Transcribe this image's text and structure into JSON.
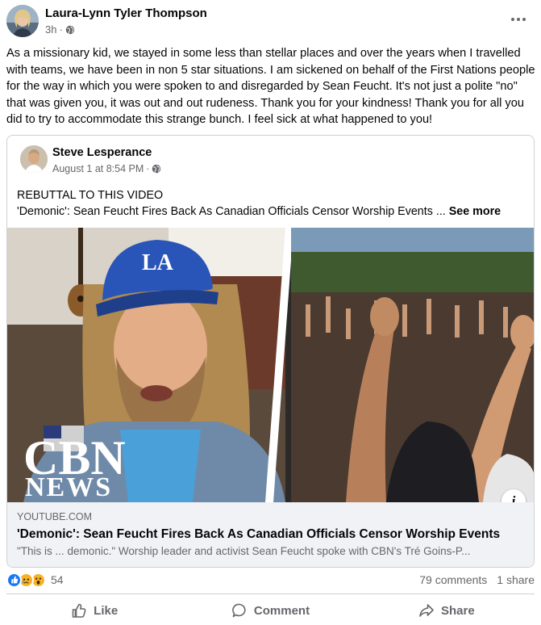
{
  "post": {
    "author": "Laura-Lynn Tyler Thompson",
    "time": "3h",
    "time_separator": "·",
    "privacy_icon": "globe-icon",
    "text": "As a missionary kid, we stayed in some less than stellar places and over the years when I travelled with teams, we have been in non 5 star situations.  I am sickened on behalf of the First Nations people for the way in which you were spoken to and disregarded by Sean Feucht.   It's not just a polite \"no\" that was given you, it was out and out rudeness. Thank you for your kindness!  Thank you for all you did to try to accommodate this strange bunch.  I feel sick at what happened to you!"
  },
  "shared": {
    "author": "Steve Lesperance",
    "date": "August 1 at 8:54 PM",
    "time_separator": "·",
    "text_line1": "REBUTTAL TO THIS VIDEO",
    "text_line2": "'Demonic': Sean Feucht Fires Back As Canadian Officials Censor Worship Events ...",
    "see_more": "See more",
    "thumbnail_logo_line1": "CBN",
    "thumbnail_logo_line2": "NEWS",
    "cap_logo": "LA",
    "info_label": "i",
    "link_domain": "YOUTUBE.COM",
    "link_title": "'Demonic': Sean Feucht Fires Back As Canadian Officials Censor Worship Events",
    "link_desc": "\"This is ... demonic.\" Worship leader and activist Sean Feucht spoke with CBN's Tré Goins-P..."
  },
  "engagement": {
    "reaction_icons": [
      "like-icon",
      "sad-icon",
      "wow-icon"
    ],
    "reaction_count": "54",
    "comments": "79 comments",
    "shares": "1 share"
  },
  "actions": {
    "like": "Like",
    "comment": "Comment",
    "share": "Share"
  },
  "colors": {
    "brand_blue": "#1877f2",
    "secondary_text": "#65676b",
    "reaction_yellow": "#f7b125"
  }
}
